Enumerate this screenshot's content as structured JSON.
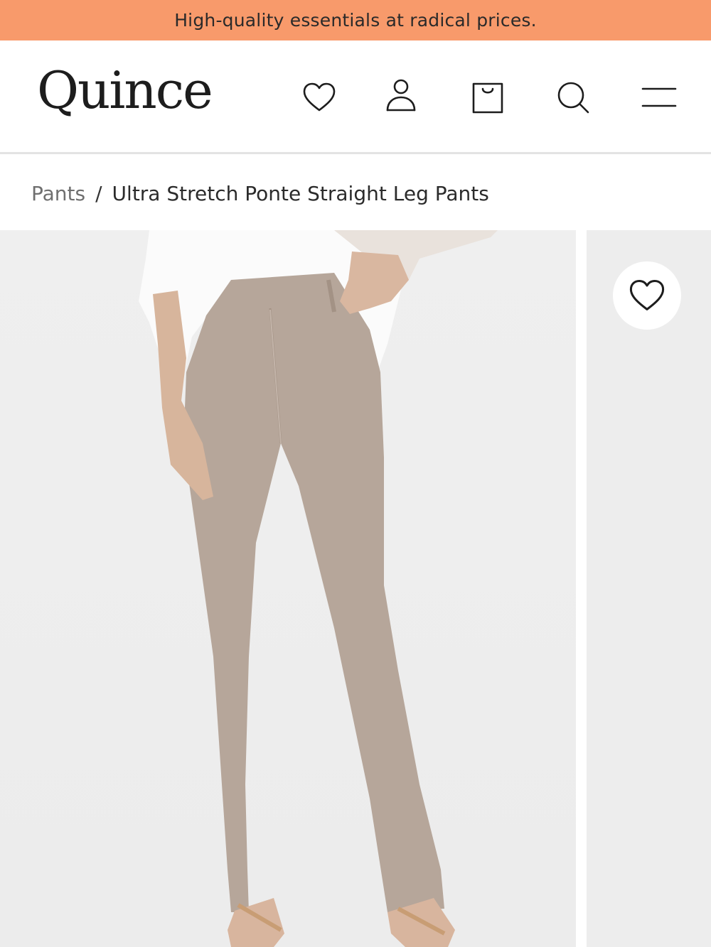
{
  "promo": {
    "text": "High-quality essentials at radical prices."
  },
  "header": {
    "logo": "Quince",
    "icons": [
      "heart-icon",
      "user-icon",
      "shopping-bag-icon",
      "search-icon",
      "menu-icon"
    ]
  },
  "breadcrumb": {
    "parent": "Pants",
    "separator": "/",
    "current": "Ultra Stretch Ponte Straight Leg Pants"
  },
  "gallery": {
    "favorite_icon": "heart-icon"
  },
  "colors": {
    "promo_bg": "#f89a6b",
    "pants": "#b6a69a",
    "photo_bg": "#eeeeee"
  }
}
